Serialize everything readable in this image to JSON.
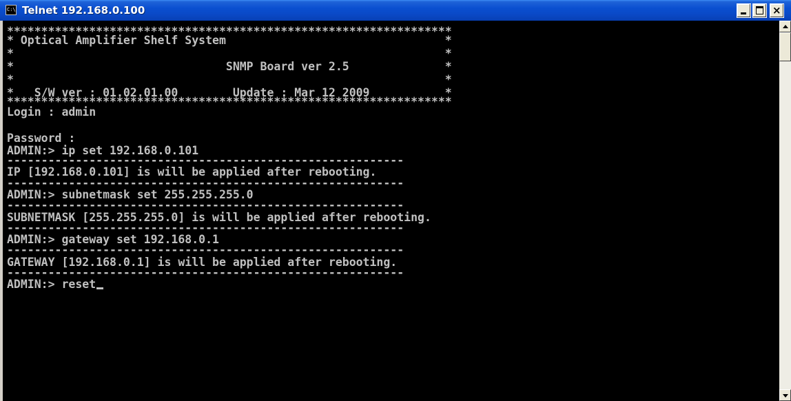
{
  "window": {
    "title": "Telnet 192.168.0.100",
    "icon_name": "console-icon",
    "icon_text": "C:\\",
    "buttons": {
      "minimize": "minimize",
      "maximize": "maximize",
      "close": "close"
    },
    "close_glyph": "×"
  },
  "console": {
    "background": "#000000",
    "foreground": "#c0c0c0",
    "lines": [
      "*****************************************************************",
      "* Optical Amplifier Shelf System                                *",
      "*                                                               *",
      "*                               SNMP Board ver 2.5              *",
      "*                                                               *",
      "*   S/W ver : 01.02.01.00        Update : Mar 12 2009           *",
      "*****************************************************************",
      "Login : admin",
      "",
      "Password :",
      "ADMIN:> ip set 192.168.0.101",
      "----------------------------------------------------------",
      "IP [192.168.0.101] is will be applied after rebooting.",
      "----------------------------------------------------------",
      "ADMIN:> subnetmask set 255.255.255.0",
      "----------------------------------------------------------",
      "SUBNETMASK [255.255.255.0] is will be applied after rebooting.",
      "----------------------------------------------------------",
      "ADMIN:> gateway set 192.168.0.1",
      "----------------------------------------------------------",
      "GATEWAY [192.168.0.1] is will be applied after rebooting.",
      "----------------------------------------------------------",
      "ADMIN:> reset"
    ]
  },
  "scrollbar": {
    "up_icon": "scroll-up-arrow-icon",
    "down_icon": "scroll-down-arrow-icon"
  }
}
